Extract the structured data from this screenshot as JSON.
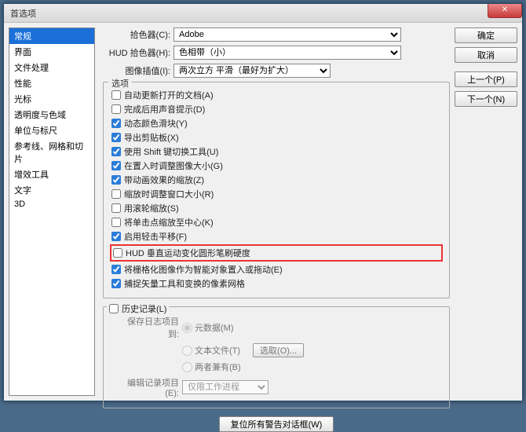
{
  "window": {
    "title": "首选项",
    "close": "✕"
  },
  "sidebar": {
    "items": [
      {
        "label": "常规",
        "selected": true
      },
      {
        "label": "界面"
      },
      {
        "label": "文件处理"
      },
      {
        "label": "性能"
      },
      {
        "label": "光标"
      },
      {
        "label": "透明度与色域"
      },
      {
        "label": "单位与标尺"
      },
      {
        "label": "参考线、网格和切片"
      },
      {
        "label": "增效工具"
      },
      {
        "label": "文字"
      },
      {
        "label": "3D"
      }
    ]
  },
  "buttons": {
    "ok": "确定",
    "cancel": "取消",
    "prev": "上一个(P)",
    "next": "下一个(N)"
  },
  "pickers": {
    "color_label": "拾色器(C):",
    "color_value": "Adobe",
    "hud_label": "HUD 拾色器(H):",
    "hud_value": "色相带（小）",
    "interp_label": "图像插值(I):",
    "interp_value": "两次立方 平滑（最好为扩大）"
  },
  "options": {
    "legend": "选项",
    "items": [
      {
        "label": "自动更新打开的文档(A)",
        "checked": false
      },
      {
        "label": "完成后用声音提示(D)",
        "checked": false
      },
      {
        "label": "动态颜色滑块(Y)",
        "checked": true
      },
      {
        "label": "导出剪贴板(X)",
        "checked": true
      },
      {
        "label": "使用 Shift 键切换工具(U)",
        "checked": true
      },
      {
        "label": "在置入时调整图像大小(G)",
        "checked": true
      },
      {
        "label": "带动画效果的缩放(Z)",
        "checked": true
      },
      {
        "label": "缩放时调整窗口大小(R)",
        "checked": false
      },
      {
        "label": "用滚轮缩放(S)",
        "checked": false
      },
      {
        "label": "将单击点缩放至中心(K)",
        "checked": false
      },
      {
        "label": "启用轻击平移(F)",
        "checked": true
      },
      {
        "label": "HUD 垂直运动变化圆形笔刷硬度",
        "checked": false,
        "highlight": true
      },
      {
        "label": "将栅格化图像作为智能对象置入或拖动(E)",
        "checked": true
      },
      {
        "label": "捕捉矢量工具和变换的像素网格",
        "checked": true
      }
    ]
  },
  "history": {
    "checkbox": "历史记录(L)",
    "save_label": "保存日志项目到:",
    "r1": "元数据(M)",
    "r2": "文本文件(T)",
    "r3": "两者兼有(B)",
    "choose": "选取(O)...",
    "edit_label": "编辑记录项目(E):",
    "edit_value": "仅限工作进程"
  },
  "reset_btn": "复位所有警告对话框(W)"
}
